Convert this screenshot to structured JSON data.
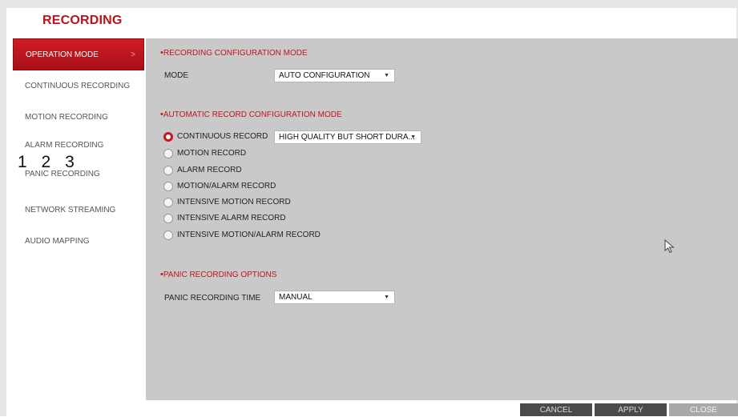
{
  "header": {
    "title": "RECORDING"
  },
  "sidebar": {
    "items": [
      {
        "label": "OPERATION MODE",
        "active": true
      },
      {
        "label": "CONTINUOUS RECORDING"
      },
      {
        "label": "MOTION RECORDING"
      },
      {
        "label": "ALARM RECORDING"
      },
      {
        "label": "PANIC RECORDING"
      },
      {
        "label": "NETWORK STREAMING"
      },
      {
        "label": "AUDIO MAPPING"
      }
    ],
    "chevron": ">",
    "numbers": [
      "1",
      "2",
      "3"
    ]
  },
  "recording_config": {
    "title": "RECORDING CONFIGURATION MODE",
    "mode_label": "MODE",
    "mode_value": "AUTO CONFIGURATION"
  },
  "auto_config": {
    "title": "AUTOMATIC RECORD CONFIGURATION MODE",
    "options": [
      {
        "label": "CONTINUOUS RECORD",
        "selected": true
      },
      {
        "label": "MOTION RECORD"
      },
      {
        "label": "ALARM RECORD"
      },
      {
        "label": "MOTION/ALARM RECORD"
      },
      {
        "label": "INTENSIVE MOTION RECORD"
      },
      {
        "label": "INTENSIVE ALARM RECORD"
      },
      {
        "label": "INTENSIVE MOTION/ALARM RECORD"
      }
    ],
    "quality_value": "HIGH QUALITY BUT SHORT DURA..."
  },
  "panic": {
    "title": "PANIC RECORDING OPTIONS",
    "time_label": "PANIC RECORDING TIME",
    "time_value": "MANUAL"
  },
  "footer": {
    "cancel_label": "CANCEL",
    "apply_label": "APPLY",
    "close_label": "CLOSE"
  },
  "colors": {
    "accent": "#c0141e",
    "panel": "#c9c9c9",
    "button_dark": "#4a4a4a",
    "button_light": "#a9a9a9"
  }
}
